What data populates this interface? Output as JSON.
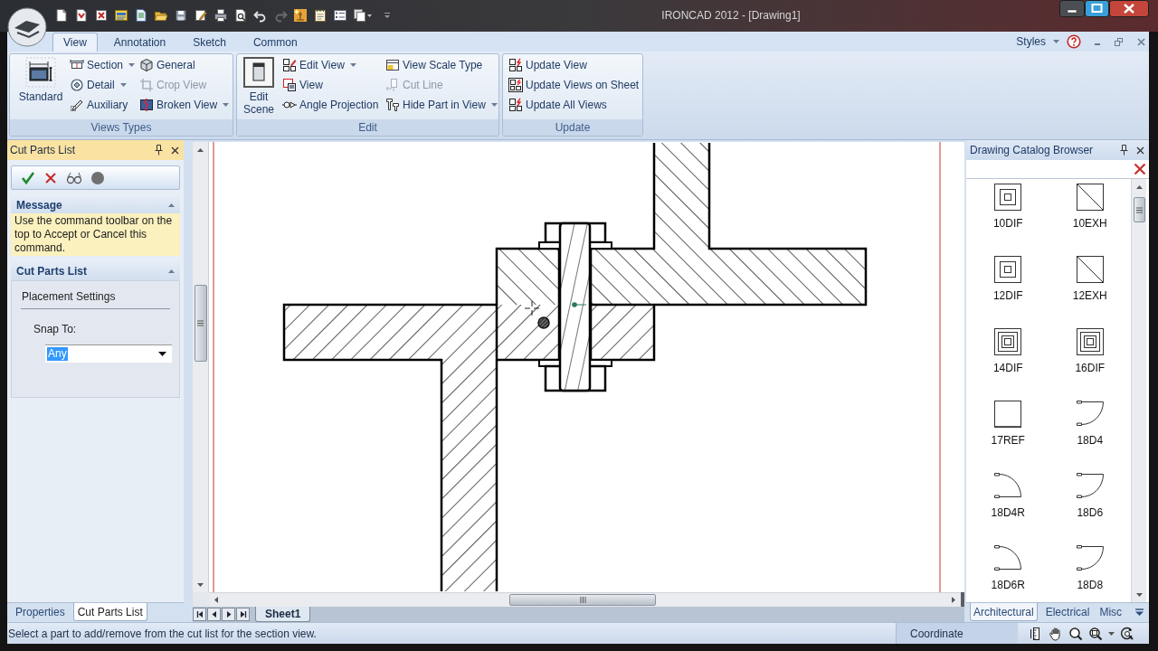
{
  "window": {
    "title": "IRONCAD 2012 - [Drawing1]"
  },
  "ribbon": {
    "tabs": [
      {
        "label": "View",
        "selected": true
      },
      {
        "label": "Annotation",
        "selected": false
      },
      {
        "label": "Sketch",
        "selected": false
      },
      {
        "label": "Common",
        "selected": false
      }
    ],
    "styles_menu": "Styles",
    "groups": [
      {
        "label": "Views Types",
        "large_button": "Standard",
        "columns": [
          [
            {
              "label": "Section",
              "dropdown": true,
              "disabled": false
            },
            {
              "label": "Detail",
              "dropdown": true,
              "disabled": false
            },
            {
              "label": "Auxiliary",
              "dropdown": false,
              "disabled": false
            }
          ],
          [
            {
              "label": "General",
              "dropdown": false,
              "disabled": false
            },
            {
              "label": "Crop View",
              "dropdown": false,
              "disabled": true
            },
            {
              "label": "Broken View",
              "dropdown": true,
              "disabled": false
            }
          ]
        ]
      },
      {
        "label": "Edit",
        "large_button": "Edit Scene",
        "columns": [
          [
            {
              "label": "Edit View",
              "dropdown": true,
              "disabled": false
            },
            {
              "label": "View",
              "dropdown": false,
              "disabled": false
            },
            {
              "label": "Angle Projection",
              "dropdown": false,
              "disabled": false
            }
          ],
          [
            {
              "label": "View Scale Type",
              "dropdown": false,
              "disabled": false
            },
            {
              "label": "Cut Line",
              "dropdown": false,
              "disabled": true
            },
            {
              "label": "Hide Part in View",
              "dropdown": true,
              "disabled": false
            }
          ]
        ]
      },
      {
        "label": "Update",
        "columns": [
          [
            {
              "label": "Update View",
              "dropdown": false,
              "disabled": false
            },
            {
              "label": "Update Views on Sheet",
              "dropdown": false,
              "disabled": false
            },
            {
              "label": "Update All Views",
              "dropdown": false,
              "disabled": false
            }
          ]
        ]
      }
    ]
  },
  "left_panel": {
    "title": "Cut Parts List",
    "message": {
      "heading": "Message",
      "text": "Use the command toolbar on the top to Accept or Cancel this command."
    },
    "options": {
      "heading": "Cut Parts List",
      "group_label": "Placement Settings",
      "field_label": "Snap To:",
      "snap_to": {
        "value": "Any",
        "highlighted": true
      }
    },
    "tabs": [
      {
        "label": "Properties",
        "selected": false
      },
      {
        "label": "Cut Parts List",
        "selected": true
      }
    ]
  },
  "sheet_tabs": [
    {
      "label": "Sheet1",
      "selected": true
    }
  ],
  "catalog": {
    "title": "Drawing Catalog Browser",
    "items": [
      {
        "label": "10DIF",
        "kind": "diffuser"
      },
      {
        "label": "10EXH",
        "kind": "exhaust"
      },
      {
        "label": "12DIF",
        "kind": "diffuser"
      },
      {
        "label": "12EXH",
        "kind": "exhaust"
      },
      {
        "label": "14DIF",
        "kind": "diffuser-large"
      },
      {
        "label": "16DIF",
        "kind": "diffuser-large"
      },
      {
        "label": "17REF",
        "kind": "register"
      },
      {
        "label": "18D4",
        "kind": "door"
      },
      {
        "label": "18D4R",
        "kind": "door-reversed"
      },
      {
        "label": "18D6",
        "kind": "door"
      },
      {
        "label": "18D6R",
        "kind": "door-reversed"
      },
      {
        "label": "18D8",
        "kind": "door"
      }
    ],
    "tabs": [
      {
        "label": "Architectural",
        "selected": true
      },
      {
        "label": "Electrical",
        "selected": false
      },
      {
        "label": "Misc",
        "selected": false
      }
    ]
  },
  "status_bar": {
    "message": "Select a part to add/remove from the cut list for the section view.",
    "coordinate": "Coordinate"
  }
}
